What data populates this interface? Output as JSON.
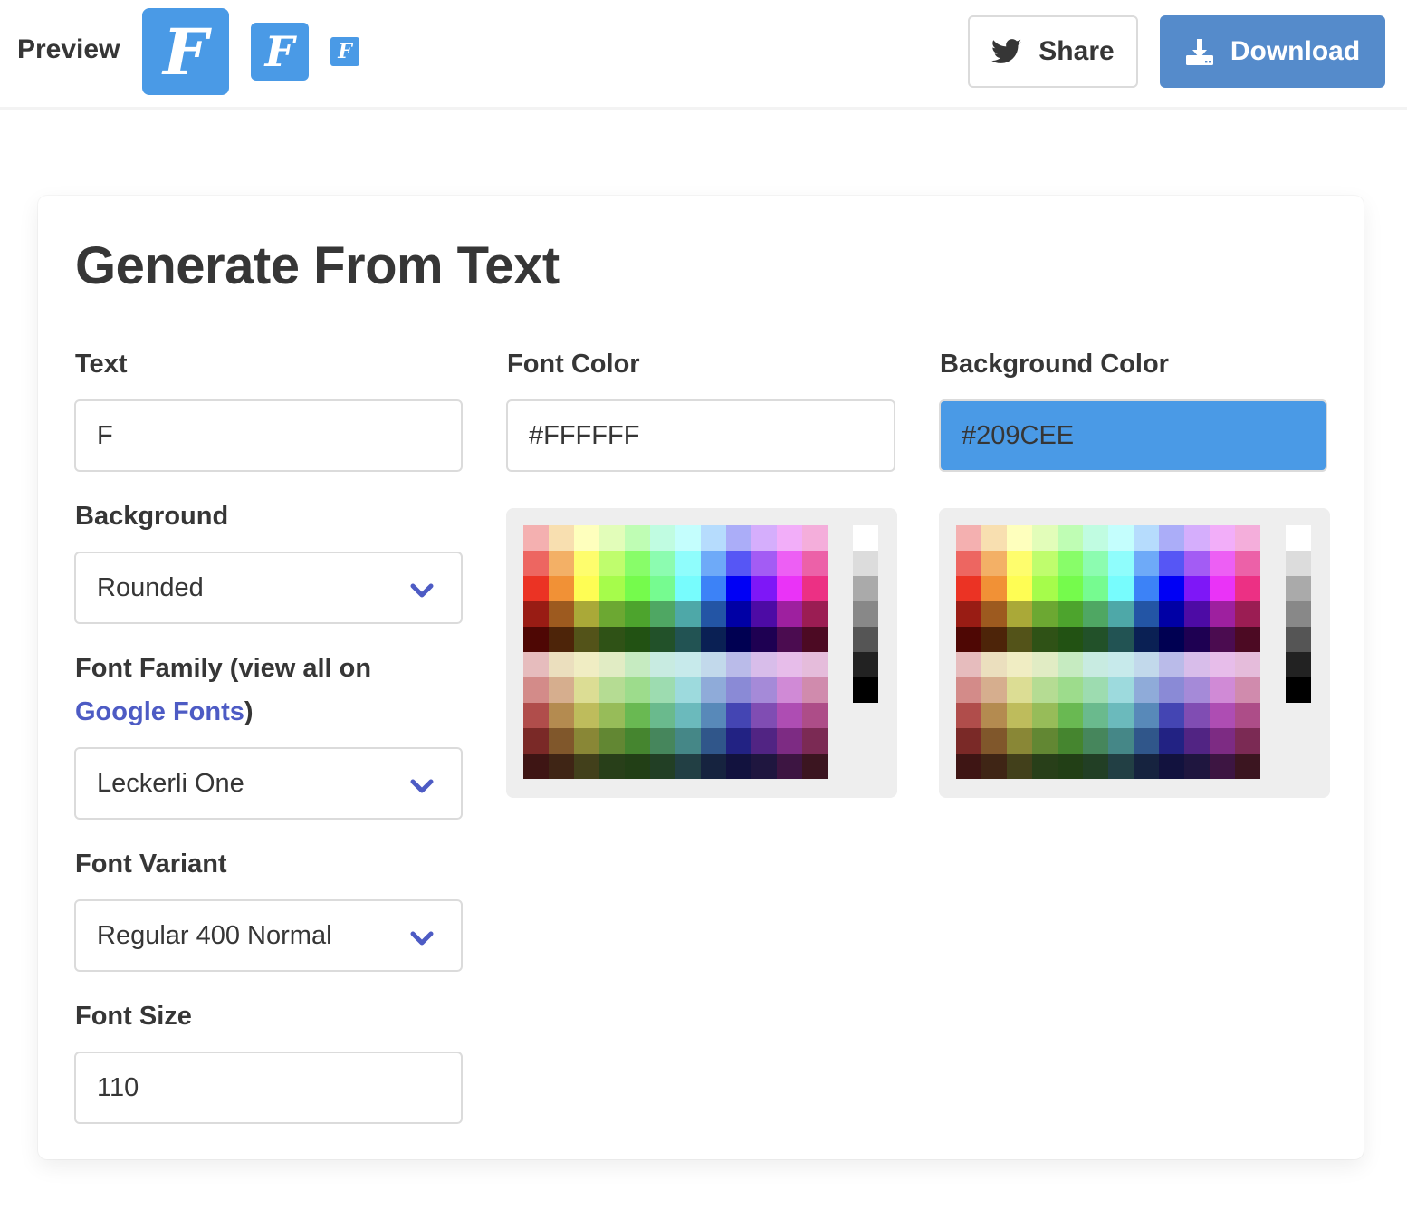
{
  "header": {
    "preview_label": "Preview",
    "preview_letter": "F",
    "share_label": "Share",
    "download_label": "Download",
    "icons": {
      "share": "twitter-bird-icon",
      "download": "download-tray-icon"
    }
  },
  "form": {
    "title": "Generate From Text",
    "text": {
      "label": "Text",
      "value": "F"
    },
    "background": {
      "label": "Background",
      "value": "Rounded"
    },
    "font_family": {
      "label_prefix": "Font Family (view all on",
      "link_text": "Google Fonts",
      "label_suffix": ")",
      "value": "Leckerli One"
    },
    "font_variant": {
      "label": "Font Variant",
      "value": "Regular 400 Normal"
    },
    "font_size": {
      "label": "Font Size",
      "value": "110"
    },
    "font_color": {
      "label": "Font Color",
      "value": "#FFFFFF"
    },
    "background_color": {
      "label": "Background Color",
      "value": "#209CEE"
    }
  },
  "colors": {
    "accent": "#4A9AE6",
    "download_button": "#558BCB",
    "link": "#4D5BC4",
    "text": "#363636"
  },
  "palette": {
    "swatches": [
      [
        "#f4b0b0",
        "#f8dfb0",
        "#feffbd",
        "#e2fdb9",
        "#bffdb4",
        "#c0fce1",
        "#c4fefd",
        "#b6dcfd",
        "#abadf8",
        "#d5aefc",
        "#f2aef9",
        "#f4aedb"
      ],
      [
        "#ed6661",
        "#f3b066",
        "#fefd6d",
        "#bffd6d",
        "#88fd69",
        "#8cfcb0",
        "#8ffdfc",
        "#6eaaf8",
        "#5656f5",
        "#a35cf4",
        "#ed5ff4",
        "#ec61a8"
      ],
      [
        "#eb3324",
        "#f19136",
        "#fefd54",
        "#a6fc4b",
        "#75fb4c",
        "#76fb90",
        "#77fcfd",
        "#3c82f7",
        "#0000f5",
        "#7e17f7",
        "#ea33f7",
        "#ec3084"
      ],
      [
        "#991c14",
        "#9d5a1f",
        "#aaa938",
        "#6ca832",
        "#4da42d",
        "#4fa763",
        "#4ea8a8",
        "#2355a5",
        "#0000a5",
        "#4d0ba5",
        "#9e209f",
        "#9b1d53"
      ],
      [
        "#4e0704",
        "#4d2409",
        "#535319",
        "#2f5216",
        "#225213",
        "#225129",
        "#225353",
        "#0a2054",
        "#000052",
        "#1e0052",
        "#4b0c50",
        "#4c0a23"
      ],
      [
        "#e6bcbd",
        "#ebdfbe",
        "#f0edc3",
        "#e1ecc4",
        "#c6ebc1",
        "#c8ebe1",
        "#c7eaeb",
        "#c2d9eb",
        "#babbe9",
        "#d8bdea",
        "#e7bdea",
        "#e5bcdb"
      ],
      [
        "#d38b89",
        "#d6ae8e",
        "#dcdd94",
        "#b5dc93",
        "#9ddc8c",
        "#9ddcb0",
        "#9ddadd",
        "#8fabd9",
        "#8a8ad6",
        "#a58ad8",
        "#d08ad6",
        "#d08bad"
      ],
      [
        "#b04d4b",
        "#b48b50",
        "#bebc5c",
        "#97bc59",
        "#69b952",
        "#6aba8d",
        "#6bbabc",
        "#5889b9",
        "#4445b3",
        "#804db3",
        "#ae4db3",
        "#ad4d88"
      ],
      [
        "#7a2927",
        "#80572b",
        "#898736",
        "#628733",
        "#45852f",
        "#46865c",
        "#458787",
        "#30568a",
        "#222283",
        "#512483",
        "#7d2b83",
        "#7b2a54"
      ],
      [
        "#3e1514",
        "#3f2515",
        "#42401b",
        "#283f19",
        "#223f16",
        "#223f25",
        "#223f44",
        "#16233f",
        "#12123e",
        "#1f163f",
        "#3d1542",
        "#3b1520"
      ]
    ],
    "grays": [
      "#ffffff",
      "#dcdcdc",
      "#aaaaaa",
      "#888888",
      "#555555",
      "#222222",
      "#000000"
    ]
  }
}
